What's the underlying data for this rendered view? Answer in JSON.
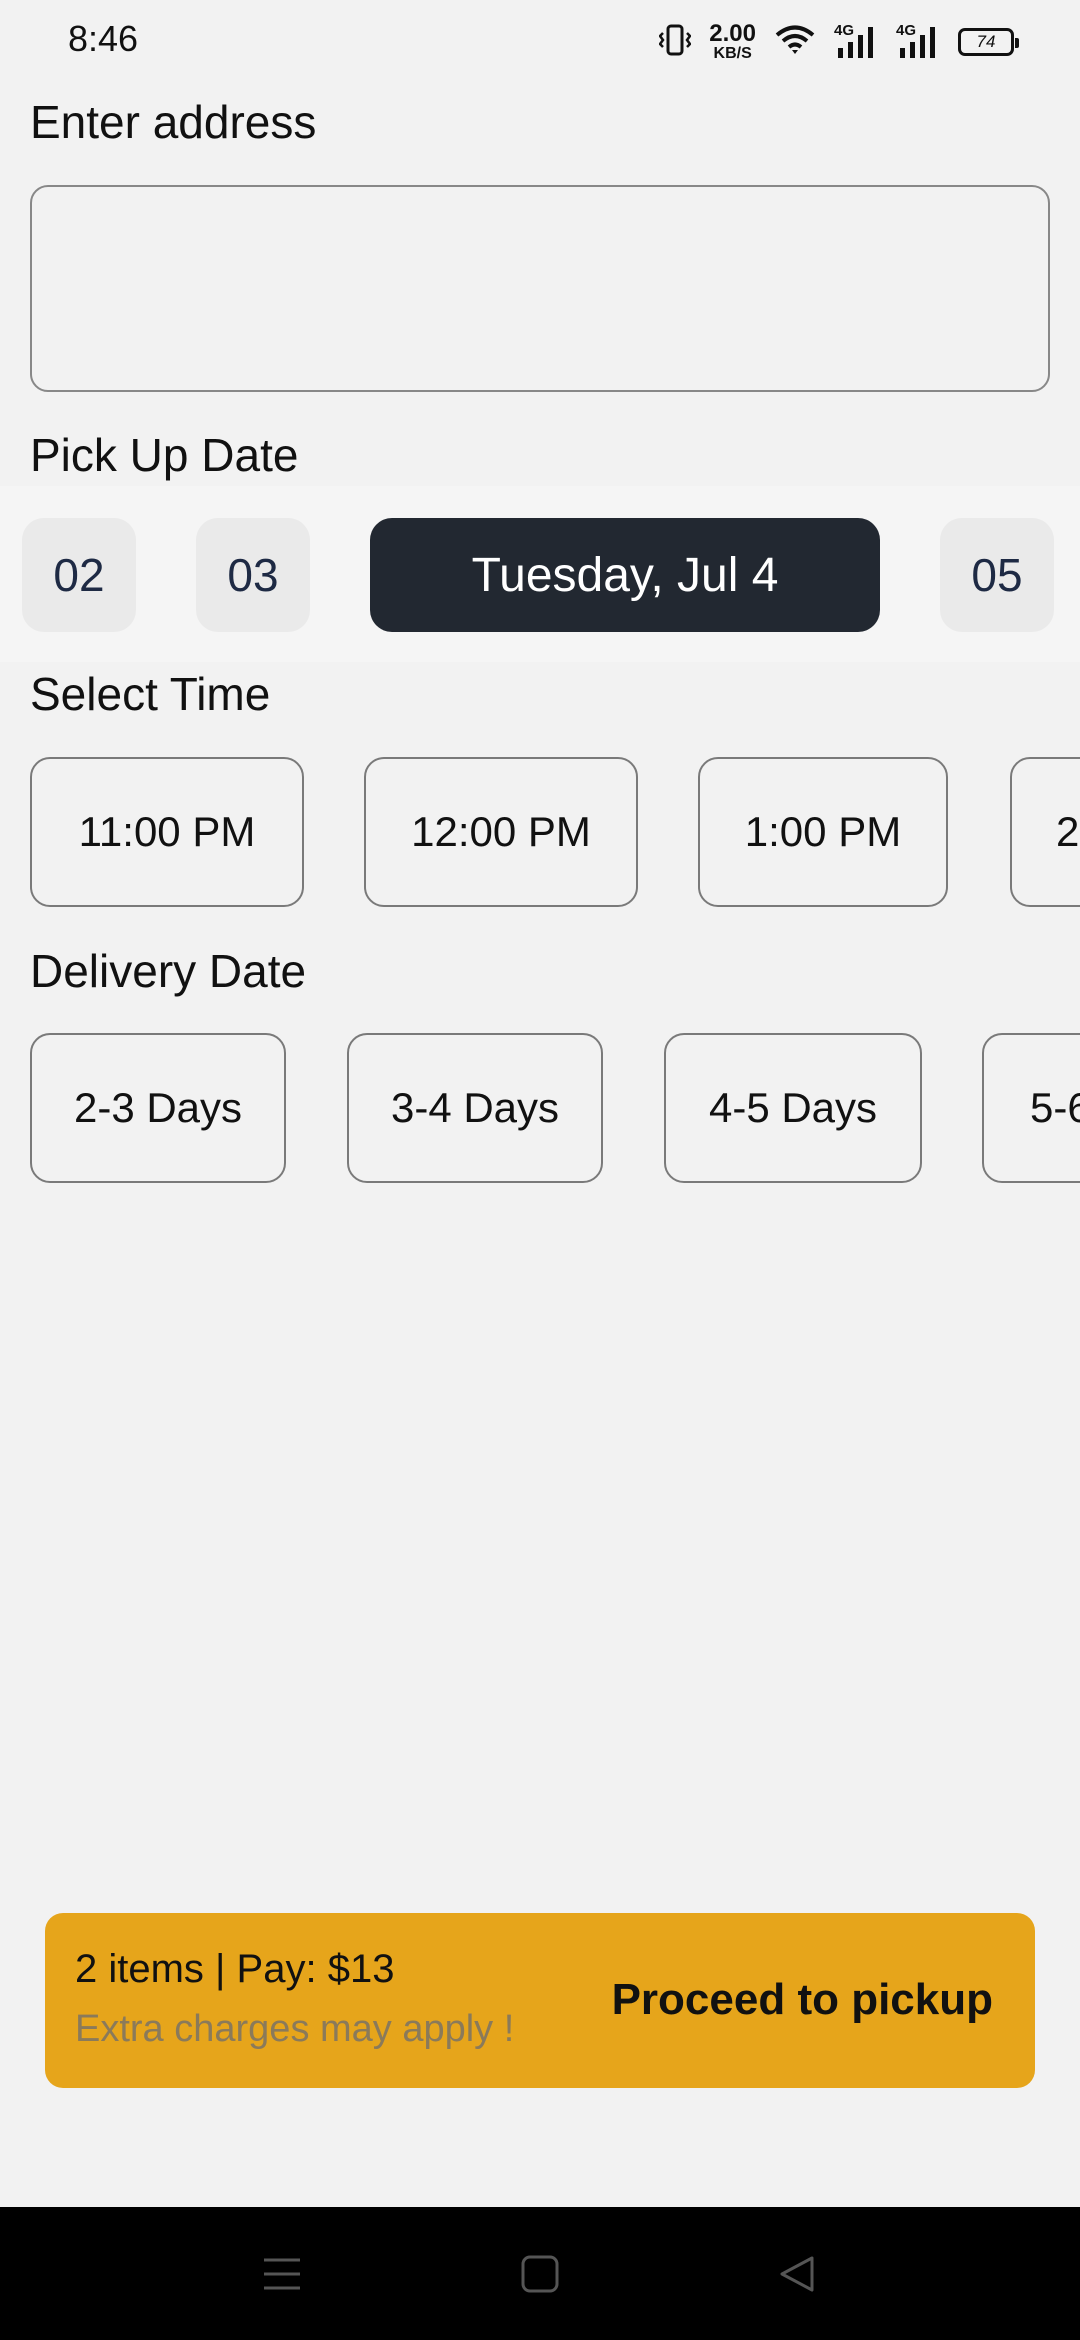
{
  "status_bar": {
    "time": "8:46",
    "net_speed_value": "2.00",
    "net_speed_unit": "KB/S",
    "network_1": "4G",
    "network_2": "4G",
    "battery": "74"
  },
  "address": {
    "label": "Enter address",
    "value": ""
  },
  "pickup_date": {
    "label": "Pick Up Date",
    "dates": [
      "02",
      "03",
      "Tuesday, Jul 4",
      "05"
    ],
    "selected": "Tuesday, Jul 4"
  },
  "time": {
    "label": "Select Time",
    "options": [
      "11:00 PM",
      "12:00 PM",
      "1:00 PM",
      "2"
    ]
  },
  "delivery": {
    "label": "Delivery Date",
    "options": [
      "2-3 Days",
      "3-4 Days",
      "4-5 Days",
      "5-6"
    ]
  },
  "proceed": {
    "summary": "2 items | Pay: $13",
    "note": "Extra charges may apply !",
    "action": "Proceed to pickup",
    "color": "#e6a51b"
  },
  "nav": {
    "icons": [
      "menu-icon",
      "home-icon",
      "back-icon"
    ]
  }
}
